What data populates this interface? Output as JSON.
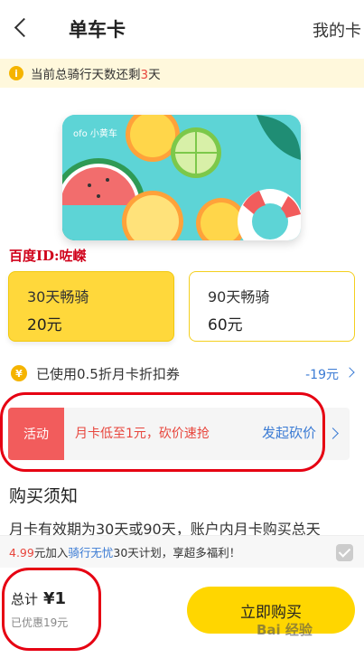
{
  "nav": {
    "title": "单车卡",
    "right_link": "我的卡"
  },
  "notice": {
    "prefix": "当前总骑行天数还剩",
    "days": "3",
    "suffix": "天"
  },
  "card": {
    "logo_text": "ofo 小黄车"
  },
  "watermark": "百度ID:咗嵥",
  "plans": [
    {
      "name": "30天畅骑",
      "price": "20元",
      "selected": true
    },
    {
      "name": "90天畅骑",
      "price": "60元",
      "selected": false
    }
  ],
  "coupon": {
    "icon": "¥",
    "text": "已使用0.5折月卡折扣券",
    "value": "-19元"
  },
  "activity": {
    "tag": "活动",
    "text": "月卡低至1元，砍价速抢",
    "link": "发起砍价"
  },
  "notes": {
    "heading": "购买须知",
    "body": "月卡有效期为30天或90天，账户内月卡购买总天"
  },
  "promo": {
    "price": "4.99",
    "mid": "元加入",
    "plan": "骑行无忧",
    "tail": "30天计划，享超多福利！"
  },
  "footer": {
    "total_label": "总计",
    "total_amount": "¥1",
    "saved": "已优惠19元",
    "buy_label": "立即购买"
  },
  "baidu_mark": "Bai 经验",
  "colors": {
    "accent_yellow": "#ffd600",
    "red": "#e8463d",
    "link_blue": "#3b7bd4"
  }
}
